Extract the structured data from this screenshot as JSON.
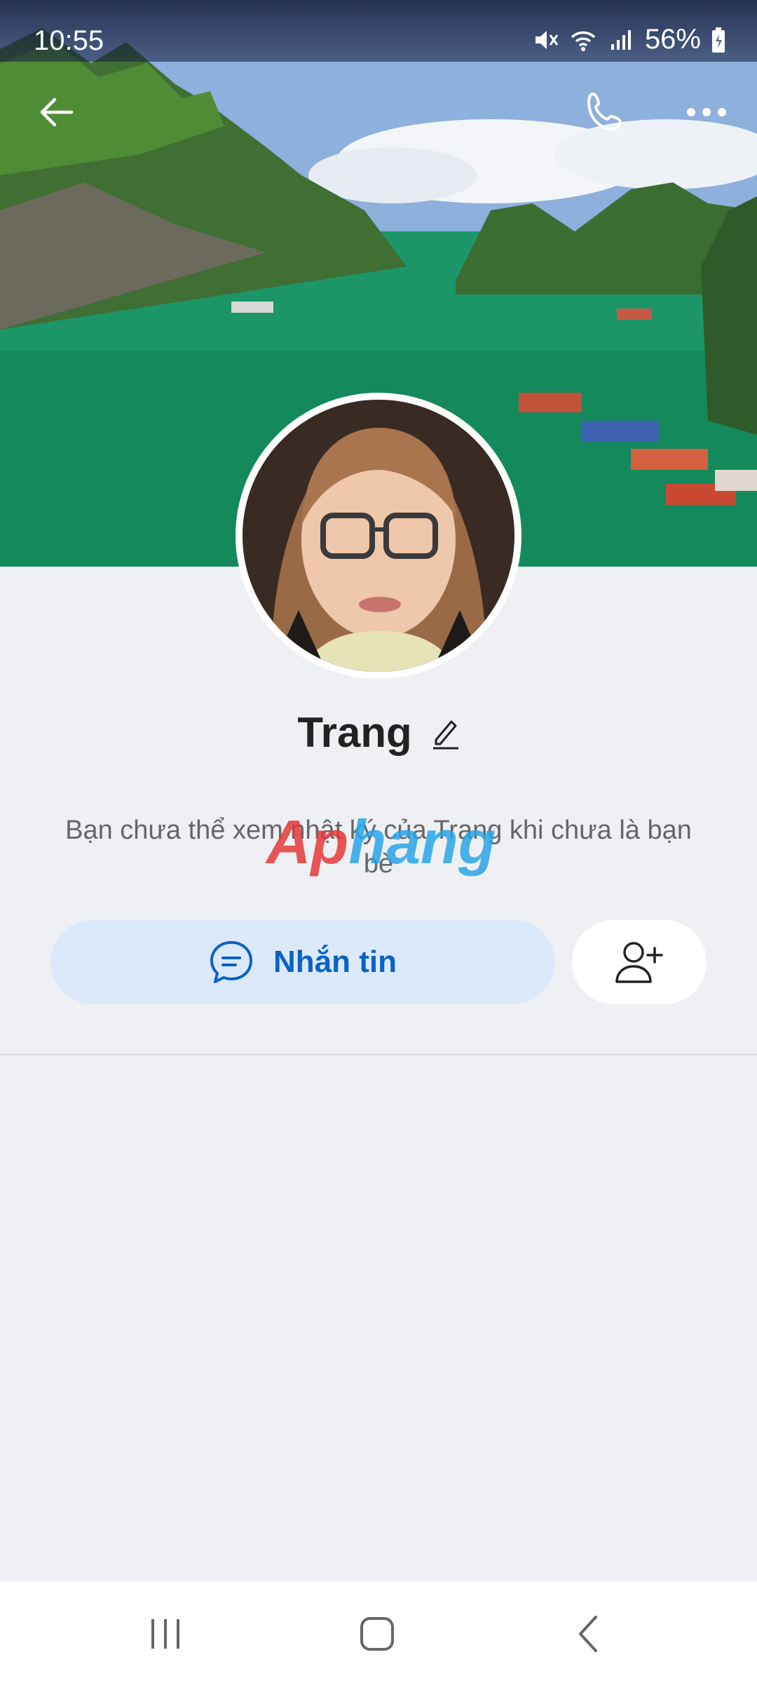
{
  "status_bar": {
    "time": "10:55",
    "battery": "56%"
  },
  "profile": {
    "name": "Trang",
    "info": "Bạn chưa thể xem nhật ký của Trang khi chưa là bạn bè"
  },
  "actions": {
    "message_label": "Nhắn tin"
  },
  "watermark": {
    "part1": "Ap",
    "part2": "hang"
  },
  "colors": {
    "accent": "#0b62c6",
    "message_bg": "#dbe9fb",
    "page_bg": "#eff0f4"
  }
}
